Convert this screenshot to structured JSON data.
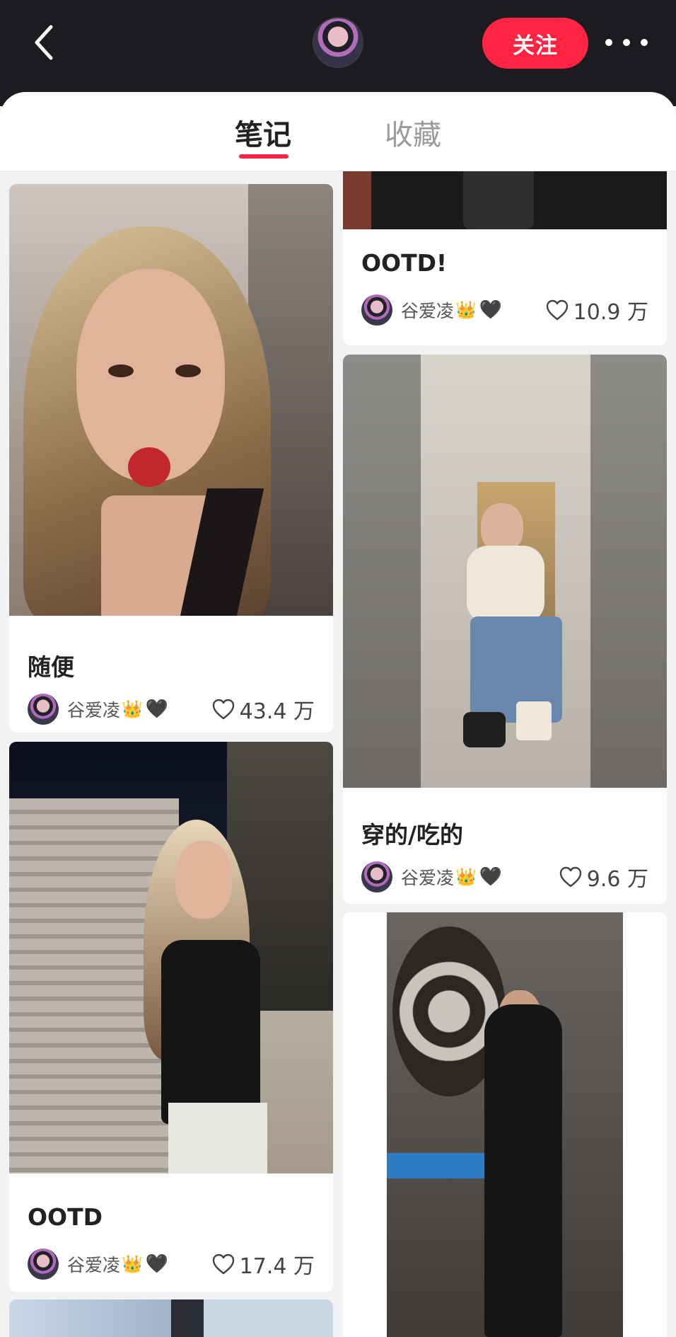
{
  "header": {
    "follow_label": "关注"
  },
  "tabs": [
    {
      "label": "笔记",
      "active": true
    },
    {
      "label": "收藏",
      "active": false
    }
  ],
  "colors": {
    "accent": "#ff2442",
    "topbar": "#1c1b1f"
  },
  "feed": {
    "left": [
      {
        "title": "随便",
        "author": "谷爱凌",
        "badges": [
          "crown-emoji",
          "black-heart-emoji"
        ],
        "likes": "43.4 万"
      },
      {
        "title": "OOTD",
        "author": "谷爱凌",
        "badges": [
          "crown-emoji",
          "black-heart-emoji"
        ],
        "likes": "17.4 万"
      }
    ],
    "right": [
      {
        "title": "OOTD!",
        "author": "谷爱凌",
        "badges": [
          "crown-emoji",
          "black-heart-emoji"
        ],
        "likes": "10.9 万"
      },
      {
        "title": "穿的/吃的",
        "author": "谷爱凌",
        "badges": [
          "crown-emoji",
          "black-heart-emoji"
        ],
        "likes": "9.6 万"
      }
    ]
  },
  "icons": {
    "crown": "👑",
    "black_heart": "🖤"
  }
}
